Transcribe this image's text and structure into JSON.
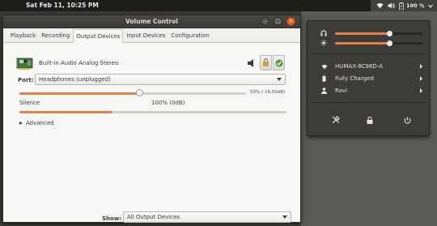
{
  "topbar": {
    "clock": "Sat Feb 11, 10:25 PM",
    "battery_percent_label": "100 %"
  },
  "window": {
    "title": "Volume Control",
    "buttons": {
      "minimize": "–",
      "maximize": "□",
      "close": "×"
    }
  },
  "tabs": [
    {
      "label": "Playback"
    },
    {
      "label": "Recording"
    },
    {
      "label": "Output Devices",
      "active": true
    },
    {
      "label": "Input Devices"
    },
    {
      "label": "Configuration"
    }
  ],
  "device": {
    "name": "Built-in Audio Analog Stereo",
    "port_label": "Port:",
    "port_value": "Headphones (unplugged)",
    "volume_percent": 53,
    "volume_readout": "53% (-16,50dB)",
    "silence_label": "Silence",
    "norm_label": "100% (0dB)",
    "balance_level": 0.35,
    "advanced_label": "Advanced"
  },
  "footer": {
    "show_label": "Show:",
    "show_value": "All Output Devices"
  },
  "menu": {
    "volume_level": 0.62,
    "brightness_level": 0.62,
    "items": [
      {
        "icon": "wifi-icon",
        "label": "HUMAX-8C96D-A"
      },
      {
        "icon": "battery-icon",
        "label": "Fully Charged"
      },
      {
        "icon": "user-icon",
        "label": "Ravi"
      }
    ],
    "actions": [
      "settings-icon",
      "lock-icon",
      "power-icon"
    ]
  },
  "colors": {
    "accent": "#e2804b",
    "panel_bg": "#3c3b37",
    "window_bg": "#f7f7f6"
  }
}
